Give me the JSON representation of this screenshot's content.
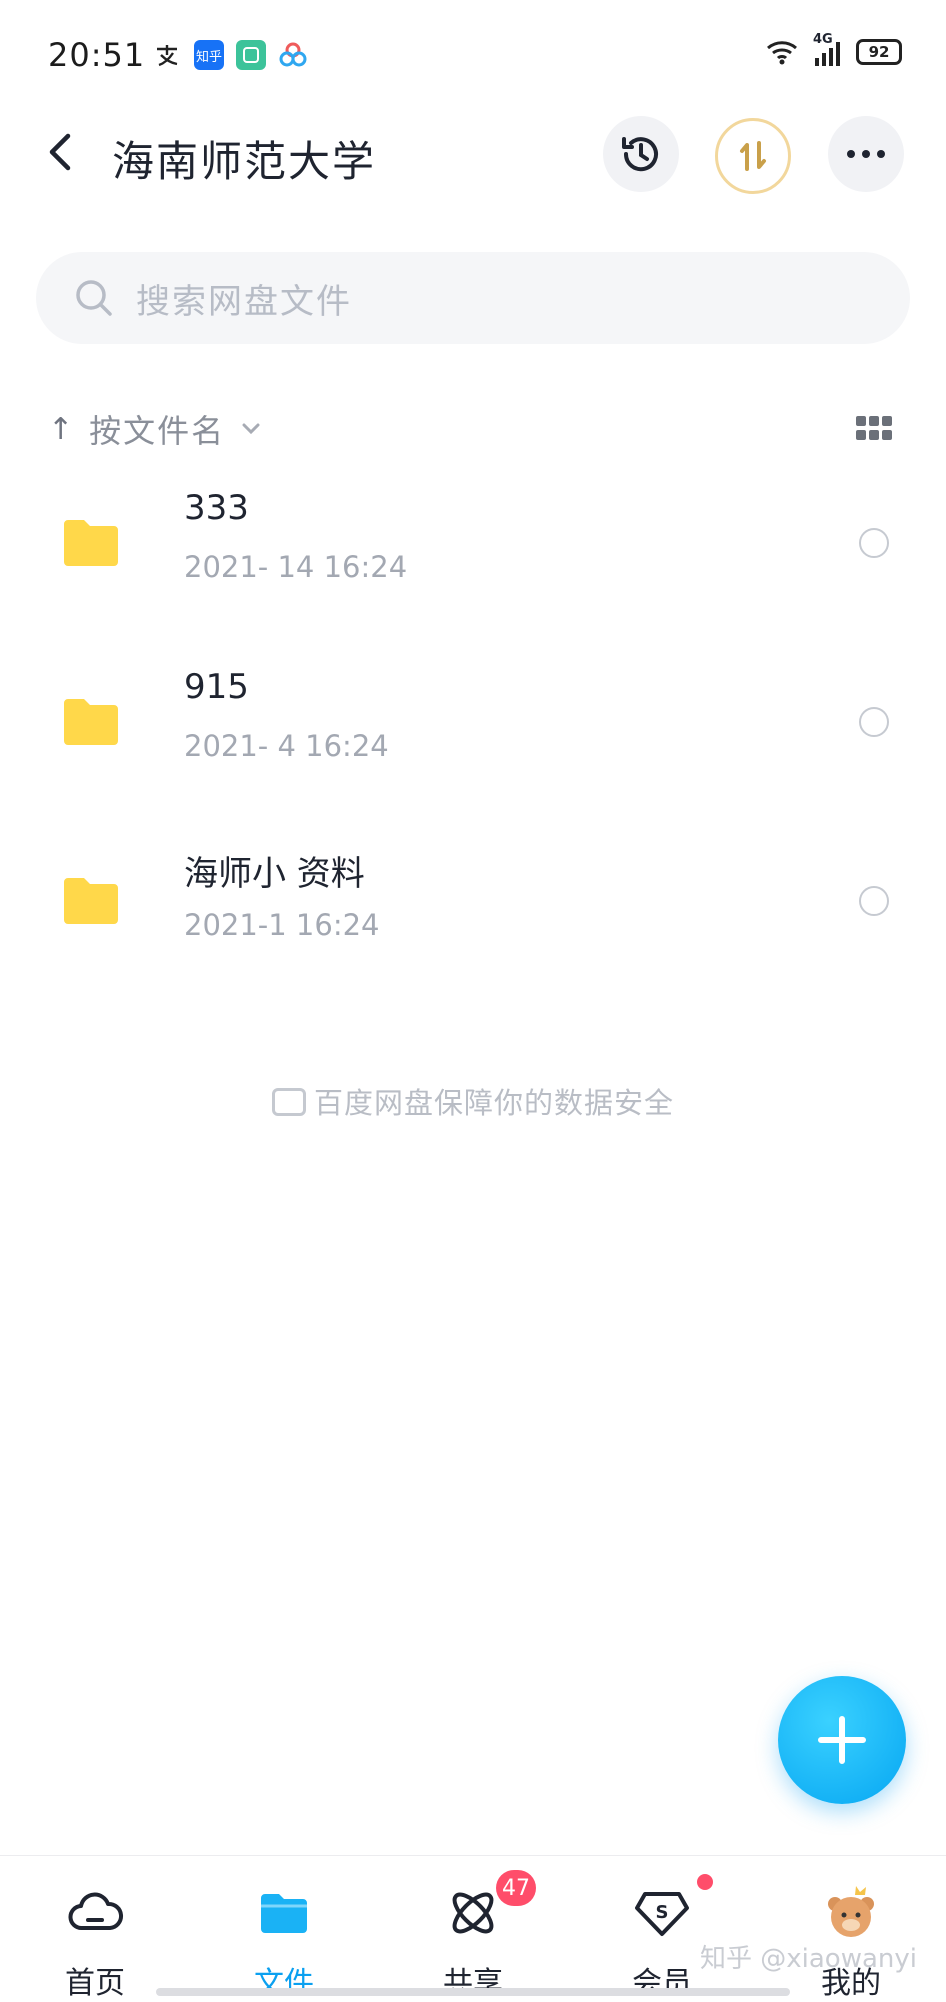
{
  "status_bar": {
    "time": "20:51",
    "app_icons": [
      "alipay-icon",
      "zhihu-icon",
      "app-icon",
      "baidu-netdisk-icon"
    ],
    "zhihu_label": "知乎",
    "network": "4G",
    "battery": "92"
  },
  "header": {
    "title": "海南师范大学",
    "history_icon": "history-icon",
    "transfer_icon": "transfer-icon",
    "more_icon": "more-icon"
  },
  "search": {
    "placeholder": "搜索网盘文件"
  },
  "sort": {
    "label": "按文件名"
  },
  "files": [
    {
      "name": "333",
      "meta": "2021-  14  16:24"
    },
    {
      "name": "915",
      "meta": "2021-   4  16:24"
    },
    {
      "name": "海师小   资料",
      "meta": "2021-1      16:24"
    }
  ],
  "safety_note": "百度网盘保障你的数据安全",
  "nav": [
    {
      "label": "首页",
      "icon": "cloud-icon"
    },
    {
      "label": "文件",
      "icon": "folder-icon",
      "active": true
    },
    {
      "label": "共享",
      "icon": "share-icon",
      "badge": "47"
    },
    {
      "label": "会员",
      "icon": "vip-icon",
      "dot": true
    },
    {
      "label": "我的",
      "icon": "avatar-icon"
    }
  ],
  "watermark": "知乎 @xiaowanyi",
  "colors": {
    "accent": "#0aa0f0",
    "folder": "#ffd84a",
    "badge": "#ff4d6a"
  }
}
